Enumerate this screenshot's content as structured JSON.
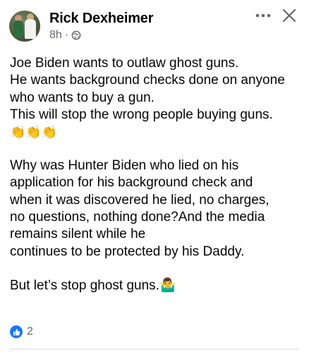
{
  "post": {
    "author": "Rick Dexheimer",
    "time": "8h",
    "separator": "·",
    "audience_icon": "globe-icon",
    "more_icon": "more-dots-icon",
    "close_icon": "close-icon",
    "lines": [
      "Joe Biden wants to outlaw ghost guns.",
      "He wants background checks done on anyone",
      "who wants to buy a gun.",
      "This will stop the wrong people buying guns.",
      "👏👏👏",
      "",
      "Why was Hunter Biden who lied on his",
      "application for his background check and",
      "when it was discovered he lied, no charges,",
      "no questions, nothing done?And the media",
      "remains silent while he",
      "continues to be protected by his Daddy.",
      "",
      "But let’s stop ghost guns.🤷‍♂️"
    ]
  },
  "reactions": {
    "icon": "like-icon",
    "count": "2"
  },
  "colors": {
    "accent": "#1877f2",
    "secondary_text": "#65676b",
    "text": "#050505"
  }
}
